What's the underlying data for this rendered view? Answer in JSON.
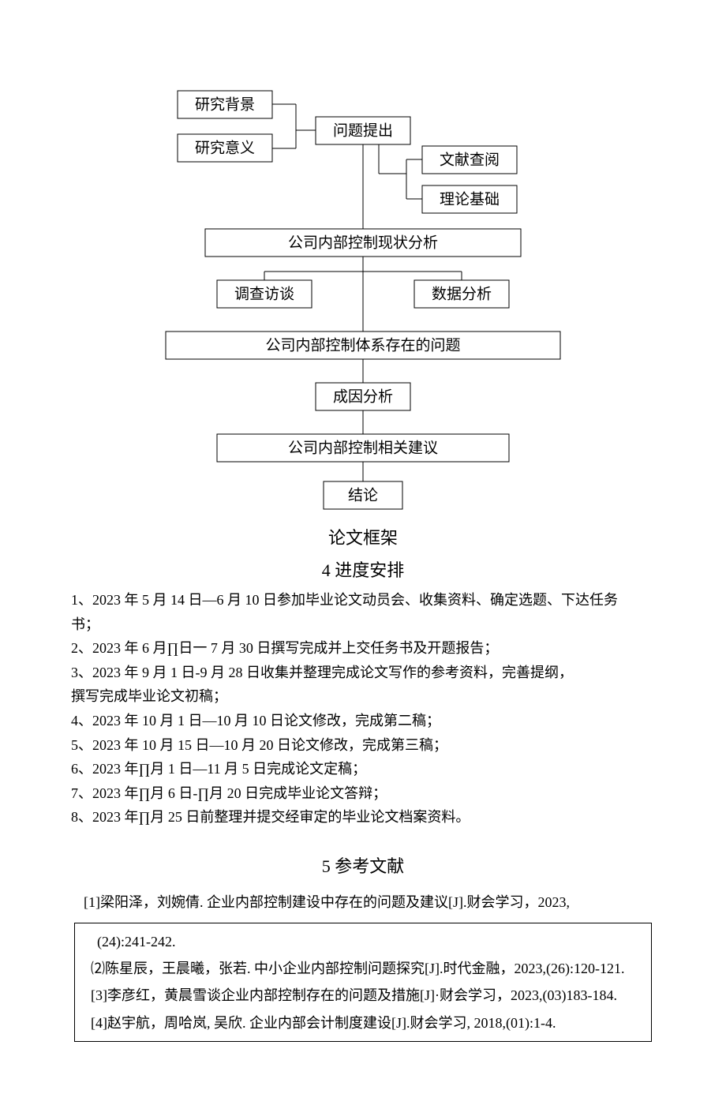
{
  "flow": {
    "n1": "研究背景",
    "n2": "研究意义",
    "n3": "问题提出",
    "n4": "文献查阅",
    "n5": "理论基础",
    "n6": "公司内部控制现状分析",
    "n7": "调查访谈",
    "n8": "数据分析",
    "n9": "公司内部控制体系存在的问题",
    "n10": "成因分析",
    "n11": "公司内部控制相关建议",
    "n12": "结论"
  },
  "caption": "论文框架",
  "schedule_heading": "4 进度安排",
  "schedule": {
    "l1": "1、2023 年 5 月 14 日—6 月 10 日参加毕业论文动员会、收集资料、确定选题、下达任务",
    "l1b": "书；",
    "l2": "2、2023 年 6 月∏日一 7 月 30 日撰写完成并上交任务书及开题报告；",
    "l3": "3、2023 年 9 月 1 日-9 月 28 日收集并整理完成论文写作的参考资料，完善提纲，",
    "l3b": "撰写完成毕业论文初稿；",
    "l4": "4、2023 年 10 月 1 日—10 月 10 日论文修改，完成第二稿；",
    "l5": "5、2023 年 10 月 15 日—10 月 20 日论文修改，完成第三稿；",
    "l6": "6、2023 年∏月 1 日—11 月 5 日完成论文定稿；",
    "l7": "7、2023 年∏月 6 日-∏月 20 日完成毕业论文答辩；",
    "l8": "8、2023 年∏月 25 日前整理并提交经审定的毕业论文档案资料。"
  },
  "refs_heading": "5 参考文献",
  "refs": {
    "r1": "[1]梁阳泽，刘婉倩. 企业内部控制建设中存在的问题及建议[J].财会学习，2023,",
    "r1b": "(24):241-242.",
    "r2": "⑵陈星辰，王晨曦，张若. 中小企业内部控制问题探究[J].时代金融，2023,(26):120-121.",
    "r3": "[3]李彦红，黄晨雪谈企业内部控制存在的问题及措施[J]·财会学习，2023,(03)183-184.",
    "r4": "[4]赵宇航，周哈岚, 吴欣. 企业内部会计制度建设[J].财会学习, 2018,(01):1-4."
  }
}
